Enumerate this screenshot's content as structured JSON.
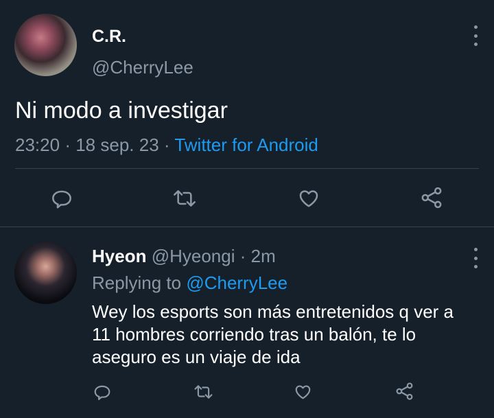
{
  "tweet": {
    "display_name": "C.R.",
    "handle": "@CherryLee",
    "text": "Ni modo a investigar",
    "time": "23:20",
    "sep": "·",
    "date": "18 sep. 23",
    "source": "Twitter for Android"
  },
  "reply": {
    "display_name": "Hyeon",
    "handle": "@Hyeongi",
    "age": "· 2m",
    "replying_prefix": "Replying to",
    "replying_to": "@CherryLee",
    "text": "Wey los esports son más entretenidos q ver a 11 hombres corriendo tras un balón, te lo aseguro es un viaje de ida"
  },
  "colors": {
    "background": "#15202b",
    "muted": "#8b98a5",
    "accent": "#1d9bf0",
    "divider": "#38444d"
  },
  "icons": [
    "more-vert-icon",
    "reply-icon",
    "retweet-icon",
    "like-icon",
    "share-icon"
  ]
}
